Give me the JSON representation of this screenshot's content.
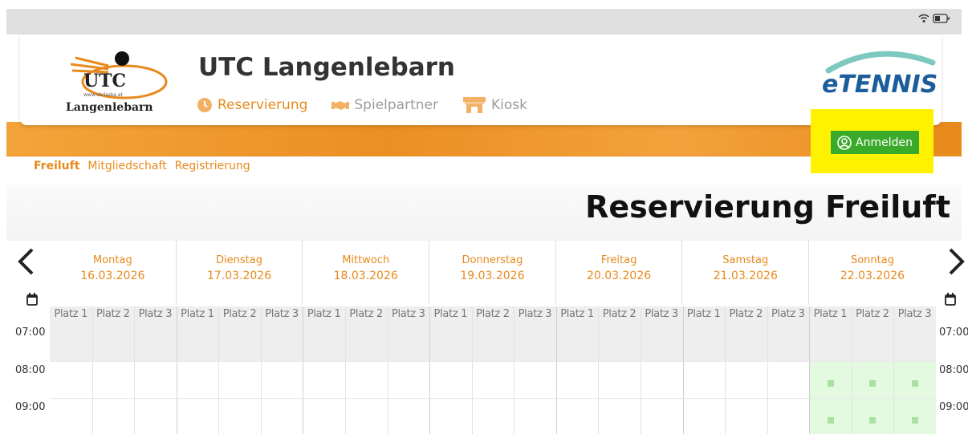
{
  "header": {
    "title": "UTC Langenlebarn",
    "logo_text_top": "UTC",
    "logo_text_url": "www.utclaske.at",
    "logo_text_bottom": "Langenlebarn",
    "brand": "eTENNIS"
  },
  "mainnav": [
    {
      "label": "Reservierung",
      "icon": "clock-icon",
      "active": true
    },
    {
      "label": "Spielpartner",
      "icon": "handshake-icon",
      "active": false
    },
    {
      "label": "Kiosk",
      "icon": "kiosk-icon",
      "active": false
    }
  ],
  "login": {
    "label": "Anmelden",
    "icon": "user-circle-icon"
  },
  "subnav": [
    {
      "label": "Freiluft",
      "active": true
    },
    {
      "label": "Mitgliedschaft",
      "active": false
    },
    {
      "label": "Registrierung",
      "active": false
    }
  ],
  "page_title": "Reservierung Freiluft",
  "calendar": {
    "days": [
      {
        "name": "Montag",
        "date": "16.03.2026"
      },
      {
        "name": "Dienstag",
        "date": "17.03.2026"
      },
      {
        "name": "Mittwoch",
        "date": "18.03.2026"
      },
      {
        "name": "Donnerstag",
        "date": "19.03.2026"
      },
      {
        "name": "Freitag",
        "date": "20.03.2026"
      },
      {
        "name": "Samstag",
        "date": "21.03.2026"
      },
      {
        "name": "Sonntag",
        "date": "22.03.2026"
      }
    ],
    "courts": [
      "Platz 1",
      "Platz 2",
      "Platz 3"
    ],
    "times_left": [
      "07:00",
      "08:00",
      "09:00"
    ],
    "times_right": [
      "07:00",
      "08:00",
      "09:00"
    ],
    "prev_label": "‹",
    "next_label": "›"
  },
  "colors": {
    "accent": "#e8891c",
    "login_bg": "#3aaa2a",
    "highlight": "#fff200",
    "free_slot": "#e3f9e0"
  }
}
